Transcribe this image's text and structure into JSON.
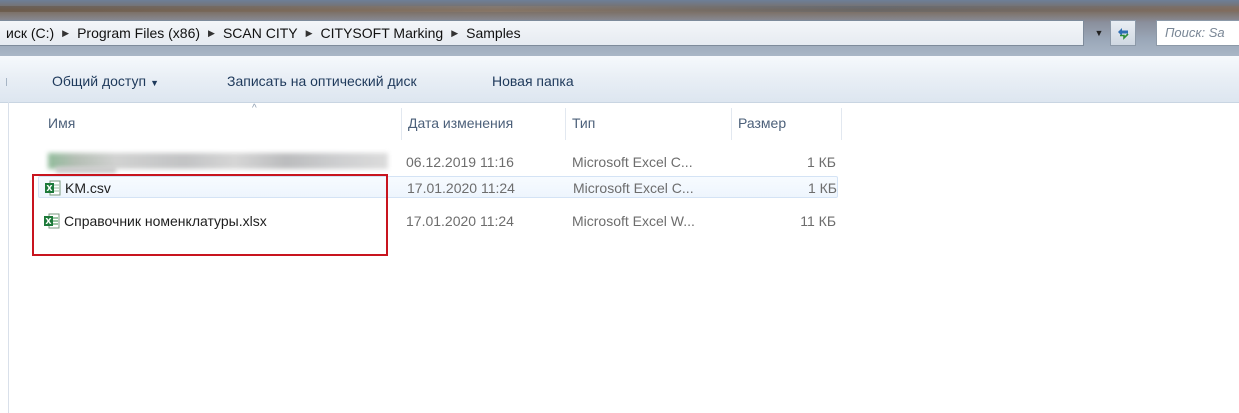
{
  "address_bar": {
    "breadcrumbs": [
      "иск (C:)",
      "Program Files (x86)",
      "SCAN CITY",
      "CITYSOFT Marking",
      "Samples"
    ],
    "search_placeholder": "Поиск: Sa"
  },
  "toolbar": {
    "share_label": "Общий доступ",
    "burn_label": "Записать на оптический диск",
    "new_folder_label": "Новая папка"
  },
  "columns": {
    "name": "Имя",
    "date": "Дата изменения",
    "type": "Тип",
    "size": "Размер"
  },
  "files": [
    {
      "name": "",
      "date": "06.12.2019 11:16",
      "type": "Microsoft Excel C...",
      "size": "1 КБ",
      "blurred": true
    },
    {
      "name": "KM.csv",
      "date": "17.01.2020 11:24",
      "type": "Microsoft Excel C...",
      "size": "1 КБ",
      "icon": "excel-csv-icon"
    },
    {
      "name": "Справочник номенклатуры.xlsx",
      "date": "17.01.2020 11:24",
      "type": "Microsoft Excel W...",
      "size": "11 КБ",
      "icon": "excel-xlsx-icon"
    }
  ],
  "colors": {
    "highlight": "#c8141e",
    "toolbar_text": "#1e395b",
    "excel_green": "#1d7a3a"
  }
}
